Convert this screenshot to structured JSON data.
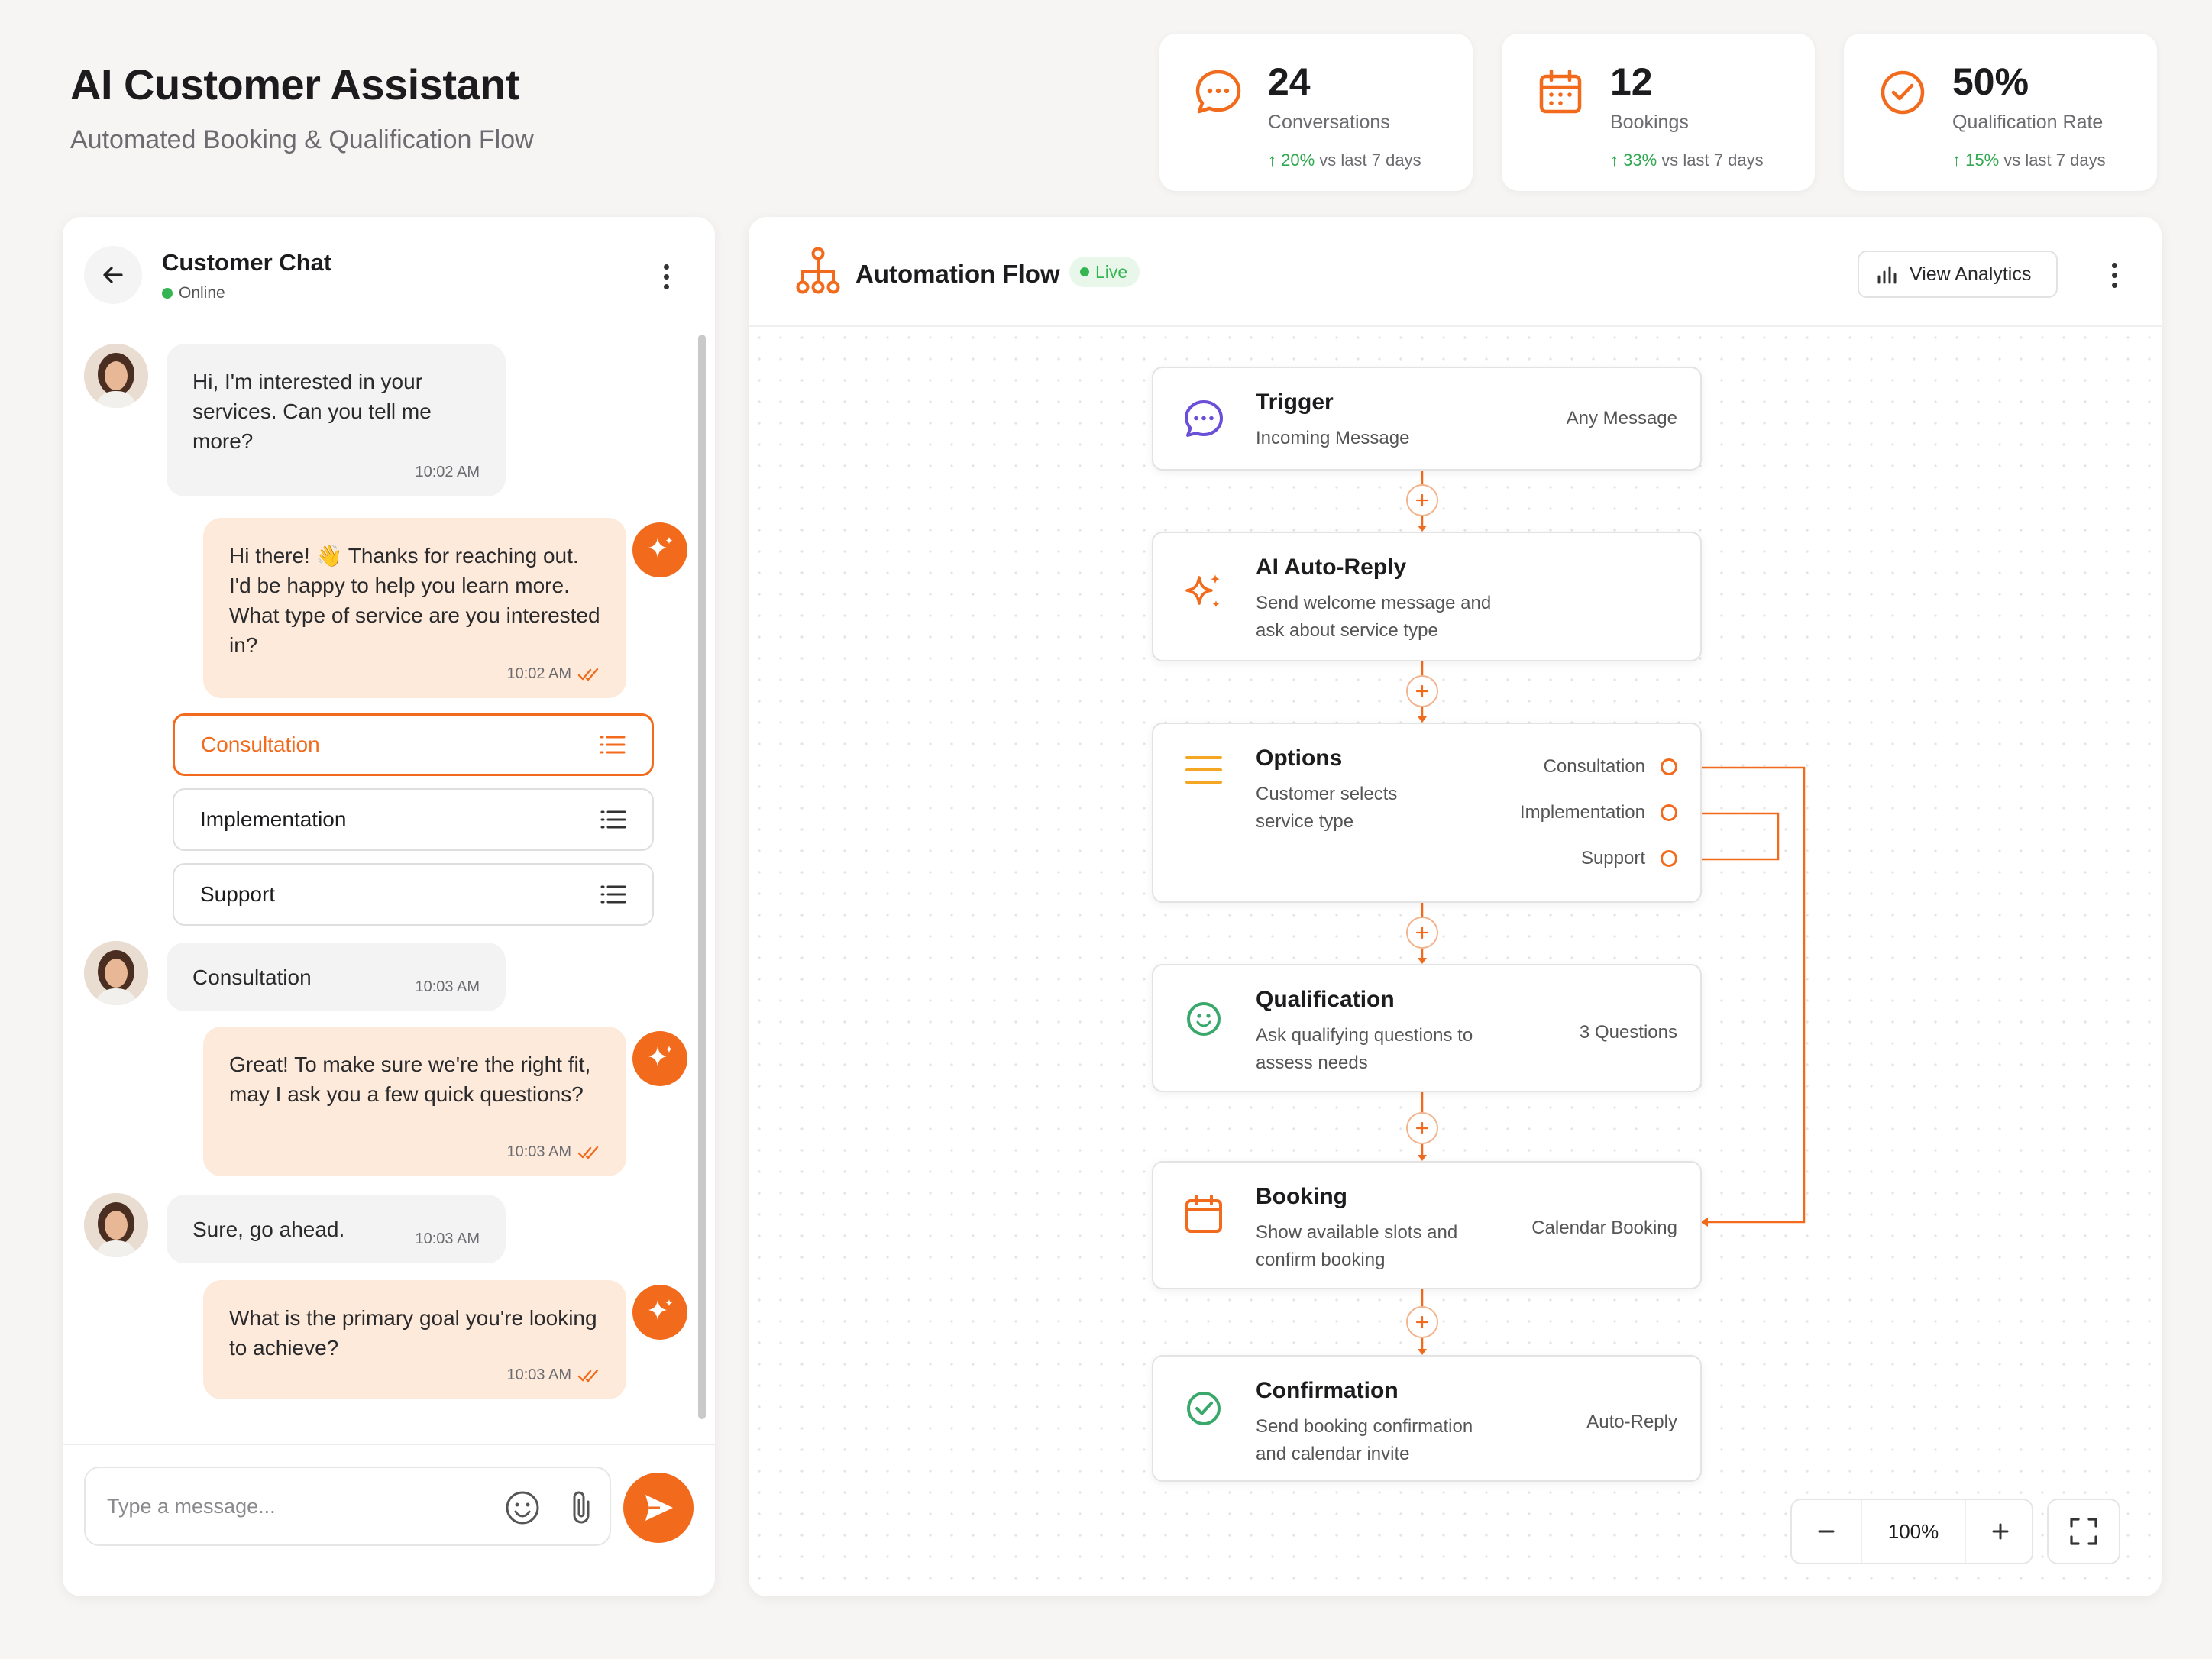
{
  "header": {
    "title": "AI Customer Assistant",
    "subtitle": "Automated Booking & Qualification Flow"
  },
  "stats": [
    {
      "icon": "chat-bubble-icon",
      "value": "24",
      "label": "Conversations",
      "change": "20%",
      "period": "vs last 7 days"
    },
    {
      "icon": "calendar-icon",
      "value": "12",
      "label": "Bookings",
      "change": "33%",
      "period": "vs last 7 days"
    },
    {
      "icon": "check-circle-icon",
      "value": "50%",
      "label": "Qualification Rate",
      "change": "15%",
      "period": "vs last 7 days"
    }
  ],
  "chat": {
    "title": "Customer Chat",
    "status": "Online",
    "messages": [
      {
        "from": "customer",
        "text": "Hi, I'm interested in your services. Can you tell me more?",
        "time": "10:02 AM"
      },
      {
        "from": "assistant",
        "text": "Hi there! 👋 Thanks for reaching out. I'd be happy to help you learn more. What type of service are you interested in?",
        "time": "10:02 AM",
        "read": true
      },
      {
        "from": "customer",
        "text": "Consultation",
        "time": "10:03 AM"
      },
      {
        "from": "assistant",
        "text": "Great! To make sure we're the right fit, may I ask you a few quick questions?",
        "time": "10:03 AM",
        "read": true
      },
      {
        "from": "customer",
        "text": "Sure, go ahead.",
        "time": "10:03 AM"
      },
      {
        "from": "assistant",
        "text": "What is the primary goal you're looking to achieve?",
        "time": "10:03 AM",
        "read": true
      }
    ],
    "options": [
      {
        "label": "Consultation",
        "selected": true
      },
      {
        "label": "Implementation",
        "selected": false
      },
      {
        "label": "Support",
        "selected": false
      }
    ],
    "input": {
      "placeholder": "Type a message...",
      "value": ""
    }
  },
  "flow": {
    "title": "Automation Flow",
    "status": "Live",
    "analytics_label": "View Analytics",
    "nodes": [
      {
        "title": "Trigger",
        "desc": "Incoming Message",
        "meta": "Any Message",
        "icon": "message-icon"
      },
      {
        "title": "AI Auto-Reply",
        "desc": "Send welcome message and ask about service type",
        "meta": "",
        "icon": "sparkle-icon"
      },
      {
        "title": "Options",
        "desc": "Customer selects service type",
        "meta": "",
        "icon": "list-icon",
        "options": [
          "Consultation",
          "Implementation",
          "Support"
        ]
      },
      {
        "title": "Qualification",
        "desc": "Ask qualifying questions to assess needs",
        "meta": "3 Questions",
        "icon": "qualification-icon"
      },
      {
        "title": "Booking",
        "desc": "Show available slots and confirm booking",
        "meta": "Calendar Booking",
        "icon": "calendar-icon"
      },
      {
        "title": "Confirmation",
        "desc": "Send booking confirmation and calendar invite",
        "meta": "Auto-Reply",
        "icon": "check-circle-icon"
      }
    ],
    "zoom": "100%"
  },
  "colors": {
    "accent": "#f26b1d",
    "accent_light": "#fdeadb",
    "success": "#2fa84f",
    "trigger_purple": "#6b4fd8",
    "qualification_green": "#3aa86b"
  }
}
